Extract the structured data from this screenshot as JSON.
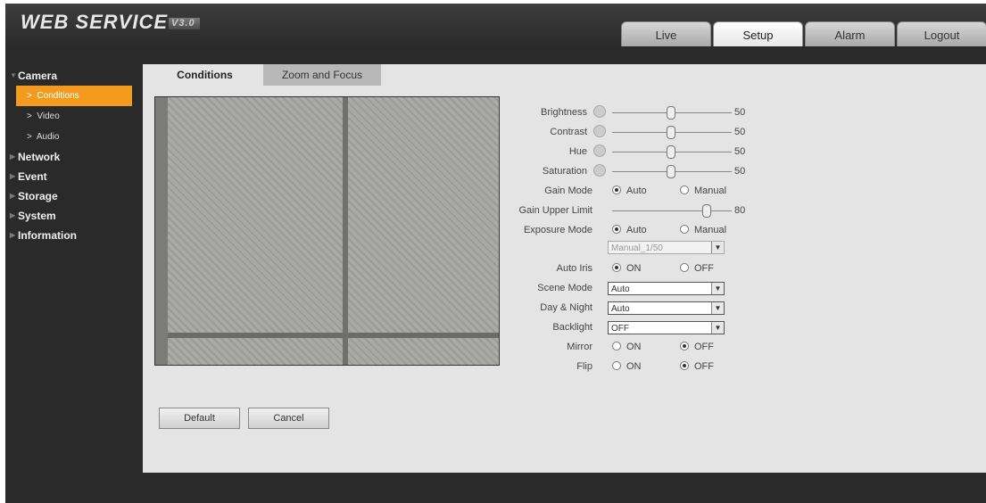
{
  "header": {
    "logo_text": "WEB  SERVICE",
    "logo_version": "V3.0",
    "nav": [
      "Live",
      "Setup",
      "Alarm",
      "Logout"
    ],
    "active": "Setup"
  },
  "sidebar": {
    "sections": [
      {
        "label": "Camera",
        "expanded": true,
        "items": [
          {
            "label": "Conditions",
            "active": true
          },
          {
            "label": "Video",
            "active": false
          },
          {
            "label": "Audio",
            "active": false
          }
        ]
      },
      {
        "label": "Network",
        "expanded": false,
        "items": []
      },
      {
        "label": "Event",
        "expanded": false,
        "items": []
      },
      {
        "label": "Storage",
        "expanded": false,
        "items": []
      },
      {
        "label": "System",
        "expanded": false,
        "items": []
      },
      {
        "label": "Information",
        "expanded": false,
        "items": []
      }
    ]
  },
  "tabs": {
    "conditions": "Conditions",
    "zoom_focus": "Zoom and Focus"
  },
  "settings": {
    "brightness": {
      "label": "Brightness",
      "value": "50",
      "level": 0.5
    },
    "contrast": {
      "label": "Contrast",
      "value": "50",
      "level": 0.5
    },
    "hue": {
      "label": "Hue",
      "value": "50",
      "level": 0.5
    },
    "saturation": {
      "label": "Saturation",
      "value": "50",
      "level": 0.5
    },
    "gain_mode": {
      "label": "Gain Mode",
      "options": [
        "Auto",
        "Manual"
      ],
      "selected": "Auto"
    },
    "gain_upper_limit": {
      "label": "Gain Upper Limit",
      "value": "80",
      "level": 0.8
    },
    "exposure_mode": {
      "label": "Exposure Mode",
      "options": [
        "Auto",
        "Manual"
      ],
      "selected": "Auto",
      "manual_value": "Manual_1/50"
    },
    "auto_iris": {
      "label": "Auto Iris",
      "options": [
        "ON",
        "OFF"
      ],
      "selected": "ON"
    },
    "scene_mode": {
      "label": "Scene Mode",
      "value": "Auto"
    },
    "day_night": {
      "label": "Day & Night",
      "value": "Auto"
    },
    "backlight": {
      "label": "Backlight",
      "value": "OFF"
    },
    "mirror": {
      "label": "Mirror",
      "options": [
        "ON",
        "OFF"
      ],
      "selected": "OFF"
    },
    "flip": {
      "label": "Flip",
      "options": [
        "ON",
        "OFF"
      ],
      "selected": "OFF"
    }
  },
  "buttons": {
    "default": "Default",
    "cancel": "Cancel"
  }
}
